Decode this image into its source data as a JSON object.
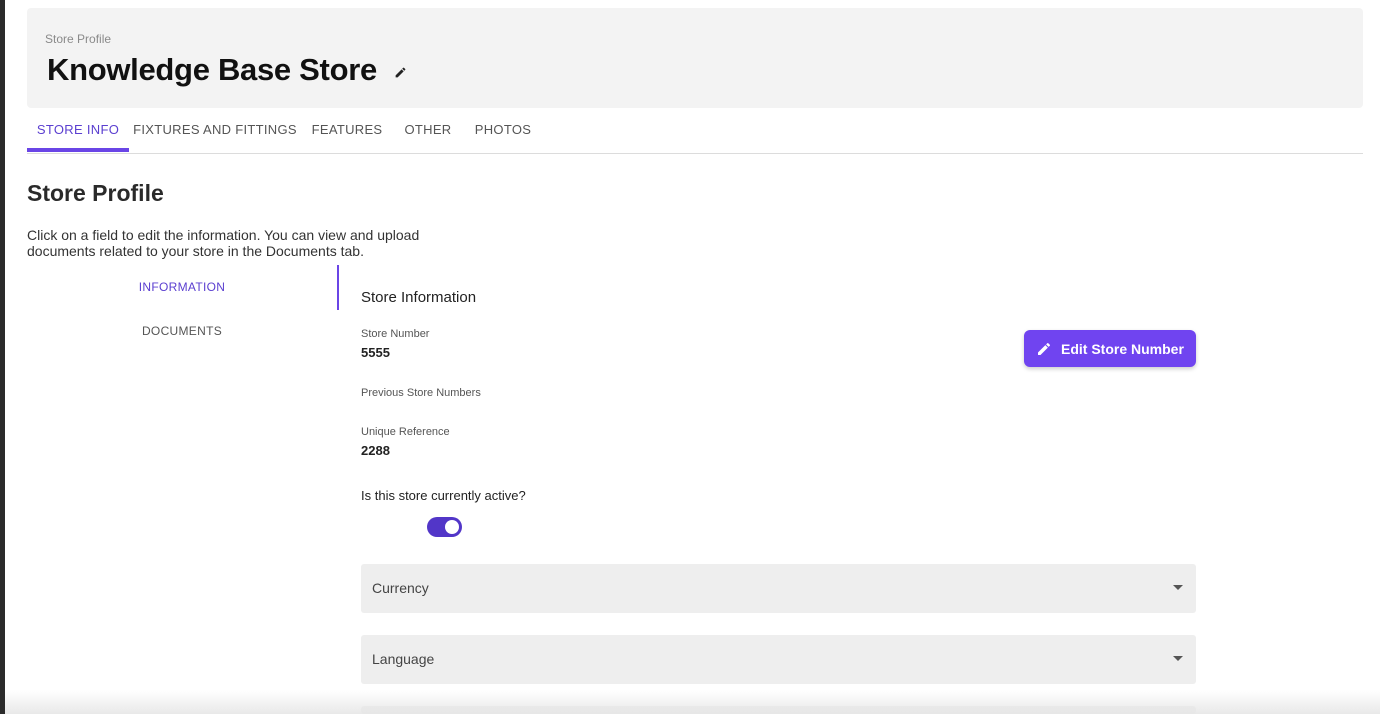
{
  "header": {
    "eyebrow": "Store Profile",
    "title": "Knowledge Base Store"
  },
  "tabs": [
    {
      "label": "STORE INFO",
      "active": true
    },
    {
      "label": "FIXTURES AND FITTINGS",
      "active": false
    },
    {
      "label": "FEATURES",
      "active": false
    },
    {
      "label": "OTHER",
      "active": false
    },
    {
      "label": "PHOTOS",
      "active": false
    }
  ],
  "section": {
    "title": "Store Profile",
    "description": "Click on a field to edit the information. You can view and upload documents related to your store in the Documents tab."
  },
  "side_nav": [
    {
      "label": "INFORMATION",
      "active": true
    },
    {
      "label": "DOCUMENTS",
      "active": false
    }
  ],
  "panel": {
    "title": "Store Information",
    "store_number_label": "Store Number",
    "store_number_value": "5555",
    "previous_numbers_label": "Previous Store Numbers",
    "unique_ref_label": "Unique Reference",
    "unique_ref_value": "2288",
    "edit_button_label": "Edit Store Number",
    "active_question": "Is this store currently active?",
    "active_toggle_on": true,
    "selects": [
      {
        "label": "Currency"
      },
      {
        "label": "Language"
      }
    ]
  },
  "colors": {
    "accent": "#6a45e6",
    "button": "#7044f0",
    "toggle": "#5236c8"
  },
  "icons": {
    "title_edit": "pencil-icon",
    "button_edit": "pencil-icon",
    "select_arrow": "caret-down-icon"
  }
}
